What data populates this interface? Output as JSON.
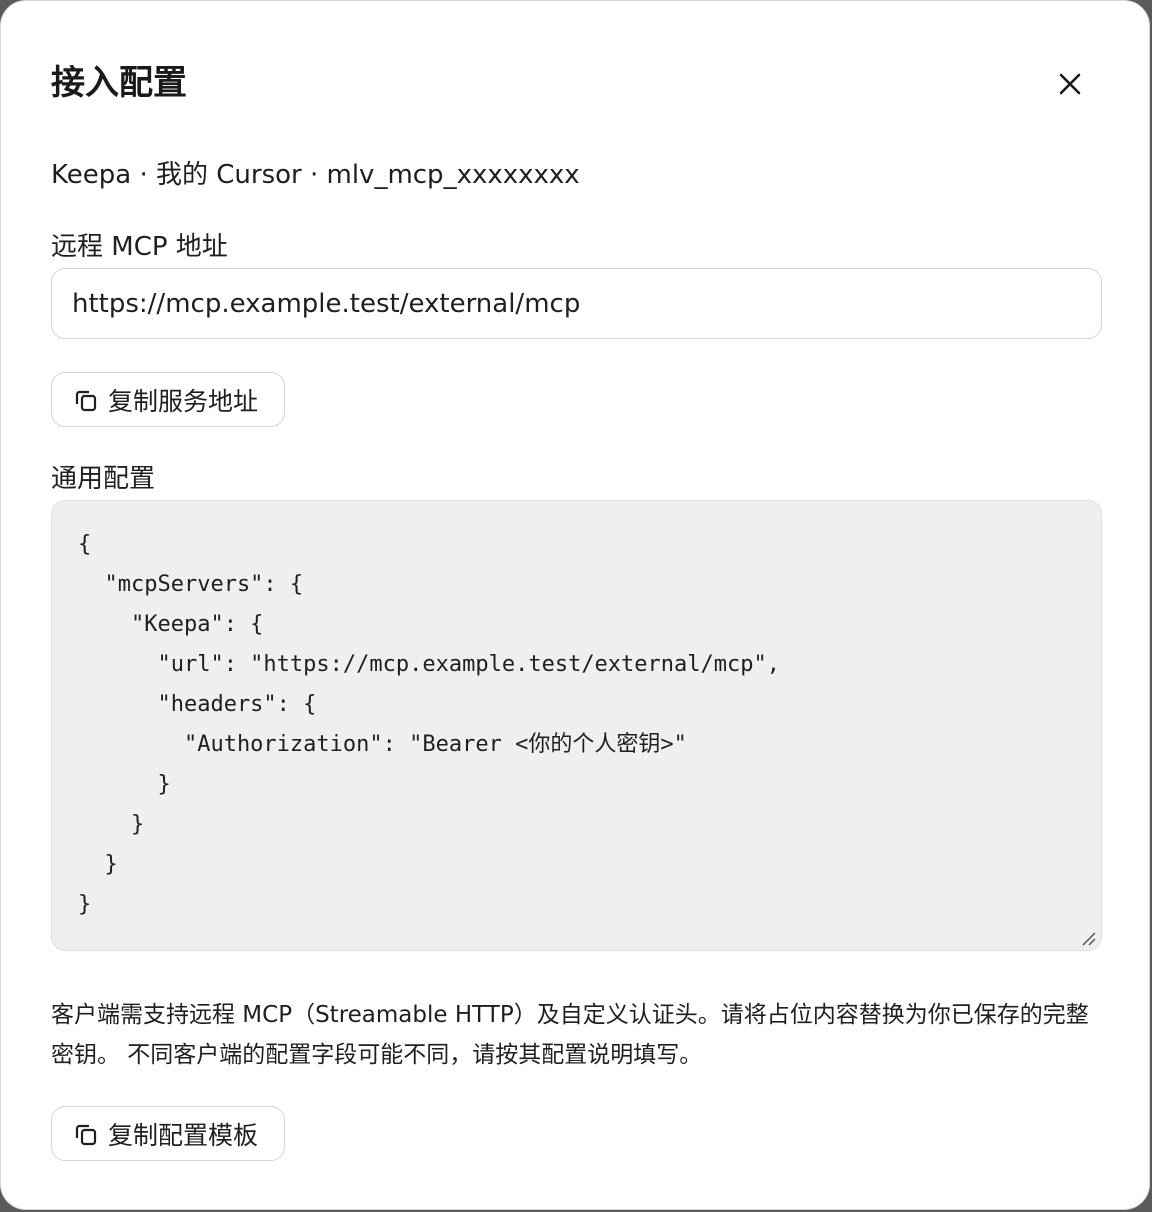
{
  "dialog": {
    "title": "接入配置",
    "close_icon": "close-icon",
    "subtitle": "Keepa · 我的 Cursor · mlv_mcp_xxxxxxxx"
  },
  "remote": {
    "label": "远程 MCP 地址",
    "url_value": "https://mcp.example.test/external/mcp",
    "copy_button_label": "复制服务地址",
    "copy_icon": "copy-icon"
  },
  "general": {
    "label": "通用配置",
    "config_text": "{\n  \"mcpServers\": {\n    \"Keepa\": {\n      \"url\": \"https://mcp.example.test/external/mcp\",\n      \"headers\": {\n        \"Authorization\": \"Bearer <你的个人密钥>\"\n      }\n    }\n  }\n}",
    "note": "客户端需支持远程 MCP（Streamable HTTP）及自定义认证头。请将占位内容替换为你已保存的完整密钥。 不同客户端的配置字段可能不同，请按其配置说明填写。",
    "copy_button_label": "复制配置模板",
    "copy_icon": "copy-icon"
  },
  "colors": {
    "surface": "#ffffff",
    "code_background": "#efefef",
    "border": "#d6d6d6",
    "text": "#1f1f1f"
  }
}
